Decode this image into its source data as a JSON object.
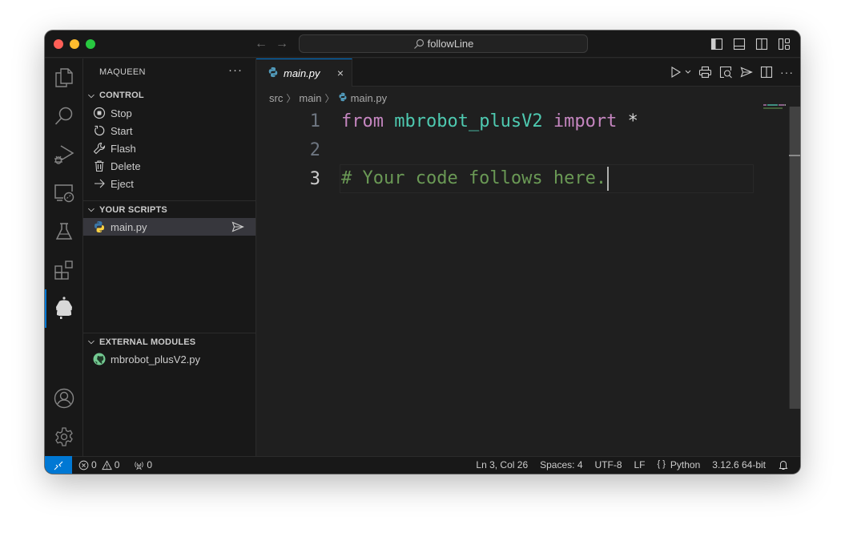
{
  "titlebar": {
    "search_text": "followLine",
    "icons": [
      "toggle-primary-sidebar-icon",
      "toggle-panel-icon",
      "toggle-secondary-sidebar-icon",
      "customize-layout-icon"
    ]
  },
  "activitybar": {
    "items": [
      {
        "name": "explorer",
        "icon": "files-icon"
      },
      {
        "name": "search",
        "icon": "search-icon"
      },
      {
        "name": "run-debug",
        "icon": "run-debug-icon"
      },
      {
        "name": "remote-explorer",
        "icon": "remote-explorer-icon"
      },
      {
        "name": "testing",
        "icon": "beaker-icon"
      },
      {
        "name": "extensions",
        "icon": "extensions-icon"
      },
      {
        "name": "maqueen",
        "icon": "robot-icon",
        "active": true
      }
    ],
    "bottom": [
      {
        "name": "accounts",
        "icon": "account-icon"
      },
      {
        "name": "manage",
        "icon": "gear-icon"
      }
    ]
  },
  "sidebar": {
    "title": "MAQUEEN",
    "more": "···",
    "sections": {
      "control": {
        "title": "CONTROL",
        "items": [
          {
            "label": "Stop",
            "icon": "stop-circle-icon"
          },
          {
            "label": "Start",
            "icon": "restart-icon"
          },
          {
            "label": "Flash",
            "icon": "wrench-icon"
          },
          {
            "label": "Delete",
            "icon": "trash-icon"
          },
          {
            "label": "Eject",
            "icon": "arrow-right-icon"
          }
        ]
      },
      "scripts": {
        "title": "YOUR SCRIPTS",
        "items": [
          {
            "label": "main.py",
            "icon": "python-icon",
            "action_icon": "send-icon"
          }
        ]
      },
      "modules": {
        "title": "EXTERNAL MODULES",
        "items": [
          {
            "label": "mbrobot_plusV2.py",
            "icon": "github-icon"
          }
        ]
      }
    }
  },
  "editor": {
    "tab": {
      "label": "main.py",
      "close": "×"
    },
    "breadcrumb": [
      "src",
      "main",
      "main.py"
    ],
    "actions": [
      "run-icon",
      "chevron-down-icon",
      "print-icon",
      "preview-icon",
      "send-icon",
      "split-editor-icon",
      "more-actions-icon"
    ],
    "lines": [
      {
        "number": "1",
        "tokens": [
          {
            "t": "from",
            "c": "kw"
          },
          {
            "t": " ",
            "c": "op"
          },
          {
            "t": "mbrobot_plusV2",
            "c": "mod"
          },
          {
            "t": " ",
            "c": "op"
          },
          {
            "t": "import",
            "c": "kw"
          },
          {
            "t": " *",
            "c": "op"
          }
        ]
      },
      {
        "number": "2",
        "tokens": []
      },
      {
        "number": "3",
        "tokens": [
          {
            "t": "# Your code follows here.",
            "c": "cm"
          }
        ],
        "current": true
      }
    ],
    "colors": {
      "keyword": "#c586c0",
      "module": "#4ec9b0",
      "comment": "#6a9955",
      "accent": "#0078d4"
    }
  },
  "statusbar": {
    "errors": "0",
    "warnings": "0",
    "ports": "0",
    "position": "Ln 3, Col 26",
    "indent": "Spaces: 4",
    "encoding": "UTF-8",
    "eol": "LF",
    "language_icon": "{ }",
    "language": "Python",
    "interpreter": "3.12.6 64-bit"
  }
}
